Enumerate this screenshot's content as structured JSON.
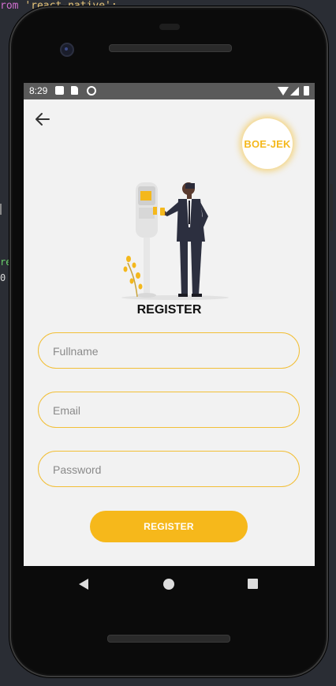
{
  "editor": {
    "line1_keyword": "rom ",
    "line1_string": "'react-native';",
    "line2": "re",
    "line3": "0"
  },
  "statusbar": {
    "time": "8:29",
    "icons": [
      "image-icon",
      "sd-card-icon",
      "sync-icon",
      "wifi-icon",
      "signal-icon",
      "battery-icon"
    ]
  },
  "header": {
    "back_icon": "arrow-left-icon",
    "logo_text": "BOE-JEK"
  },
  "form": {
    "title": "REGISTER",
    "fullname_placeholder": "Fullname",
    "email_placeholder": "Email",
    "password_placeholder": "Password",
    "submit_label": "REGISTER"
  },
  "navbar": {
    "icons": [
      "nav-back-icon",
      "nav-home-icon",
      "nav-recents-icon"
    ]
  },
  "colors": {
    "accent": "#f6b81b",
    "screen_bg": "#f2f2f2",
    "statusbar_bg": "#5a5a5a"
  }
}
